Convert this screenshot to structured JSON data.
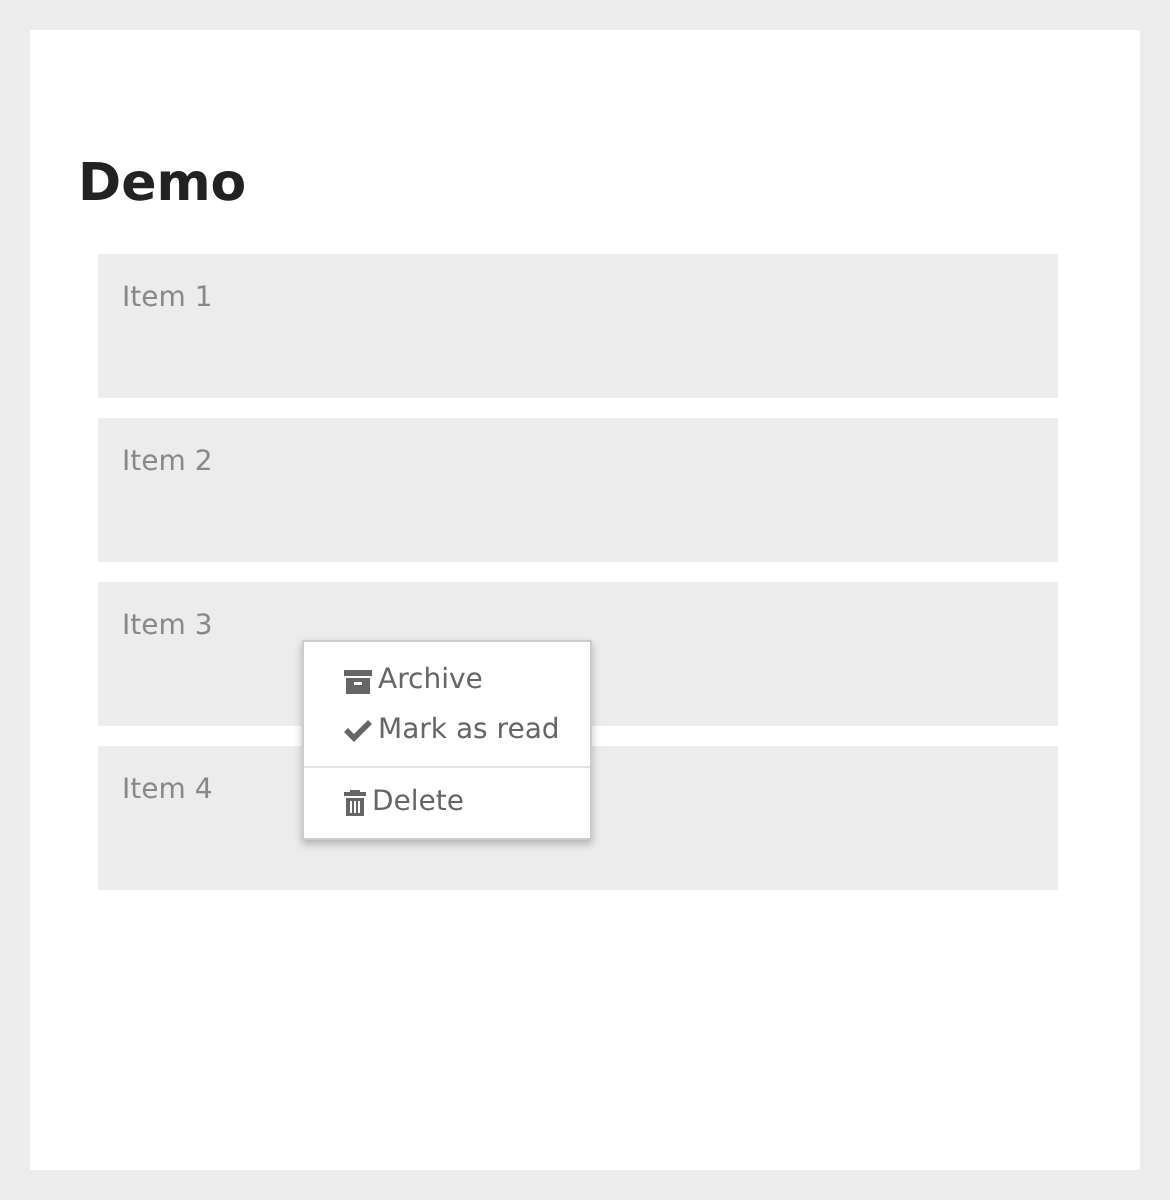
{
  "title": "Demo",
  "items": [
    {
      "label": "Item 1"
    },
    {
      "label": "Item 2"
    },
    {
      "label": "Item 3"
    },
    {
      "label": "Item 4"
    }
  ],
  "context_menu": {
    "groups": [
      [
        {
          "label": "Archive",
          "kind": "archive"
        },
        {
          "label": "Mark as read",
          "kind": "check"
        }
      ],
      [
        {
          "label": "Delete",
          "kind": "trash"
        }
      ]
    ]
  }
}
